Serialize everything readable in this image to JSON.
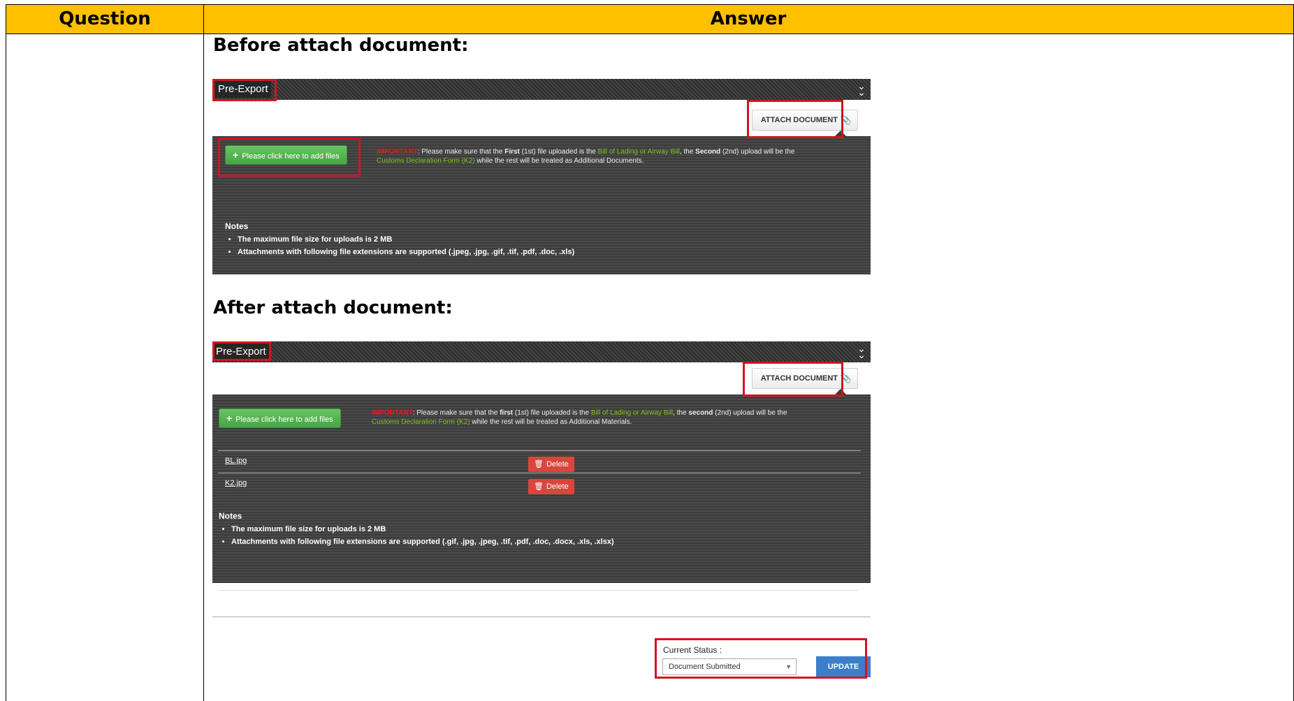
{
  "table": {
    "header_question": "Question",
    "header_answer": "Answer"
  },
  "before": {
    "caption": "Before attach document:",
    "panel_title": "Pre-Export",
    "attach_label": "ATTACH DOCUMENT",
    "add_files_label": "Please click here to add files",
    "important_label": "IMPORTANT",
    "important_text_1": ": Please make sure that the ",
    "first_word": "First",
    "important_text_2": " (1st) file uploaded is the ",
    "bill_text": "Bill of Lading or Airway Bill",
    "important_text_3": ", the ",
    "second_word": "Second",
    "important_text_4": " (2nd) upload will be the",
    "k2_text": "Customs Declaration Form (K2)",
    "important_text_5": " while the rest will be treated as Additional Documents.",
    "notes_title": "Notes",
    "notes": [
      "The maximum file size for uploads is 2 MB",
      "Attachments with following file extensions are supported (.jpeg, .jpg, .gif, .tif, .pdf, .doc, .xls)"
    ]
  },
  "after": {
    "caption": "After attach document:",
    "panel_title": "Pre-Export",
    "attach_label": "ATTACH DOCUMENT",
    "add_files_label": "Please click here to add files",
    "important_label": "IMPORTANT",
    "important_text_1": ": Please make sure that the ",
    "first_word": "first",
    "important_text_2": " (1st) file uploaded is the ",
    "bill_text": "Bill of Lading or Airway Bill",
    "important_text_3": ", the ",
    "second_word": "second",
    "important_text_4": " (2nd) upload will be the",
    "k2_text": "Customs Declaration Form (K2)",
    "important_text_5": " while the rest will be treated as Additional Materials.",
    "files": [
      {
        "name": "BL.jpg",
        "delete_label": "Delete"
      },
      {
        "name": "K2.jpg",
        "delete_label": "Delete"
      }
    ],
    "notes_title": "Notes",
    "notes": [
      "The maximum file size for uploads is 2 MB",
      "Attachments with following file extensions are supported (.gif, .jpg, .jpeg, .tif, .pdf, .doc, .docx, .xls, .xlsx)"
    ]
  },
  "status": {
    "label": "Current Status :",
    "value": "Document Submitted",
    "update_label": "UPDATE"
  },
  "colors": {
    "header_bg": "#ffc000",
    "highlight_box": "#d3141f",
    "add_button": "#48a544",
    "delete_button": "#d9463c",
    "update_button": "#3b7ec9"
  }
}
